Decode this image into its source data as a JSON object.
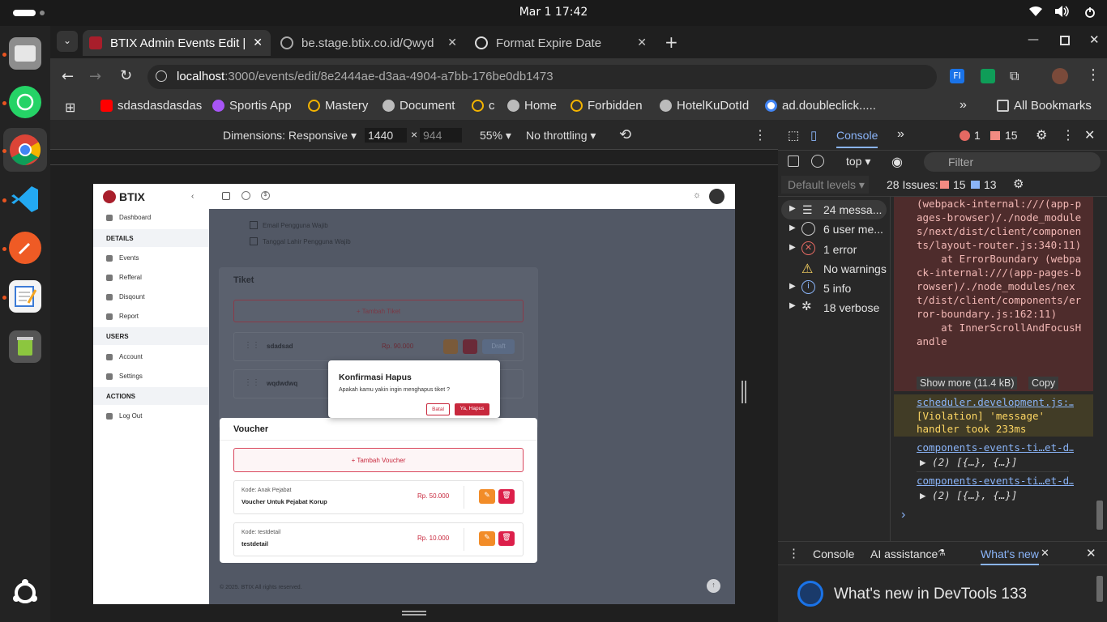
{
  "system": {
    "clock": "Mar 1  17:42"
  },
  "tabs": [
    {
      "title": "BTIX Admin Events Edit |",
      "close": "✕"
    },
    {
      "title": "be.stage.btix.co.id/Qwyd",
      "close": "✕"
    },
    {
      "title": "Format Expire Date",
      "close": "✕"
    }
  ],
  "new_tab": "+",
  "address": {
    "host": "localhost",
    "rest": ":3000/events/edit/8e2444ae-d3aa-4904-a7bb-176be0db1473"
  },
  "bookmarks": [
    "sdasdasdasdas",
    "Sportis App",
    "Mastery",
    "Document",
    "c",
    "Home",
    "Forbidden",
    "HotelKuDotId",
    "ad.doubleclick....."
  ],
  "bookmarks_more": "»",
  "all_bookmarks": "All Bookmarks",
  "device_toolbar": {
    "dimensions": "Dimensions: Responsive",
    "width": "1440",
    "times": "×",
    "height": "944",
    "zoom": "55%",
    "throttle": "No throttling"
  },
  "app": {
    "brand": "BTIX",
    "nav_dashboard": "Dashboard",
    "sections": {
      "details": "DETAILS",
      "users": "USERS",
      "actions": "ACTIONS"
    },
    "details_items": [
      "Events",
      "Refferal",
      "Disqount",
      "Report"
    ],
    "users_items": [
      "Account",
      "Settings"
    ],
    "actions_items": [
      "Log Out"
    ],
    "checkboxes": [
      "Email Pengguna Wajib",
      "Tanggal Lahir Pengguna Wajib"
    ],
    "ticket_title": "Tiket",
    "add_ticket": "+ Tambah Tiket",
    "tickets": [
      {
        "name": "sdadsad",
        "price": "Rp. 90.000",
        "status": "Draft"
      },
      {
        "name": "wqdwdwq",
        "price": "",
        "status": ""
      }
    ],
    "modal": {
      "title": "Konfirmasi Hapus",
      "message": "Apakah kamu yakin ingin menghapus tiket ?",
      "cancel": "Batal",
      "confirm": "Ya, Hapus"
    },
    "voucher_title": "Voucher",
    "add_voucher": "+ Tambah Voucher",
    "vouchers": [
      {
        "code": "Kode: Anak Pejabat",
        "name": "Voucher Untuk Pejabat Korup",
        "price": "Rp. 50.000"
      },
      {
        "code": "Kode: testdetail",
        "name": "testdetail",
        "price": "Rp. 10.000"
      }
    ],
    "footer": "© 2025. BTIX All rights reserved."
  },
  "devtools": {
    "tab_console": "Console",
    "errors": "1",
    "warnings": "15",
    "context": "top",
    "filter_placeholder": "Filter",
    "levels": "Default levels",
    "issues_label": "28 Issues:",
    "issues_warn": "15",
    "issues_info": "13",
    "sidebar": [
      "24 messa...",
      "6 user me...",
      "1 error",
      "No warnings",
      "5 info",
      "18 verbose"
    ],
    "error_trace": "(webpack-internal:///(app-pages-browser)/./node_modules/next/dist/client/components/layout-router.js:340:11)\n    at ErrorBoundary (webpack-internal:///(app-pages-browser)/./node_modules/next/dist/client/components/error-boundary.js:162:11)\n    at InnerScrollAndFocusHandle",
    "show_more": "Show more (11.4 kB)",
    "copy": "Copy",
    "violation_link": "scheduler.development.js:…",
    "violation_text": "[Violation] 'message' handler took 233ms",
    "log1_link": "components-events-ti…et-d…",
    "log1_val": "▶ (2) [{…}, {…}]",
    "log2_link": "components-events-ti…et-d…",
    "log2_val": "▶ (2) [{…}, {…}]",
    "prompt": "›",
    "drawer_tabs": [
      "Console",
      "AI assistance",
      "What's new"
    ],
    "whats_new": "What's new in DevTools 133"
  }
}
